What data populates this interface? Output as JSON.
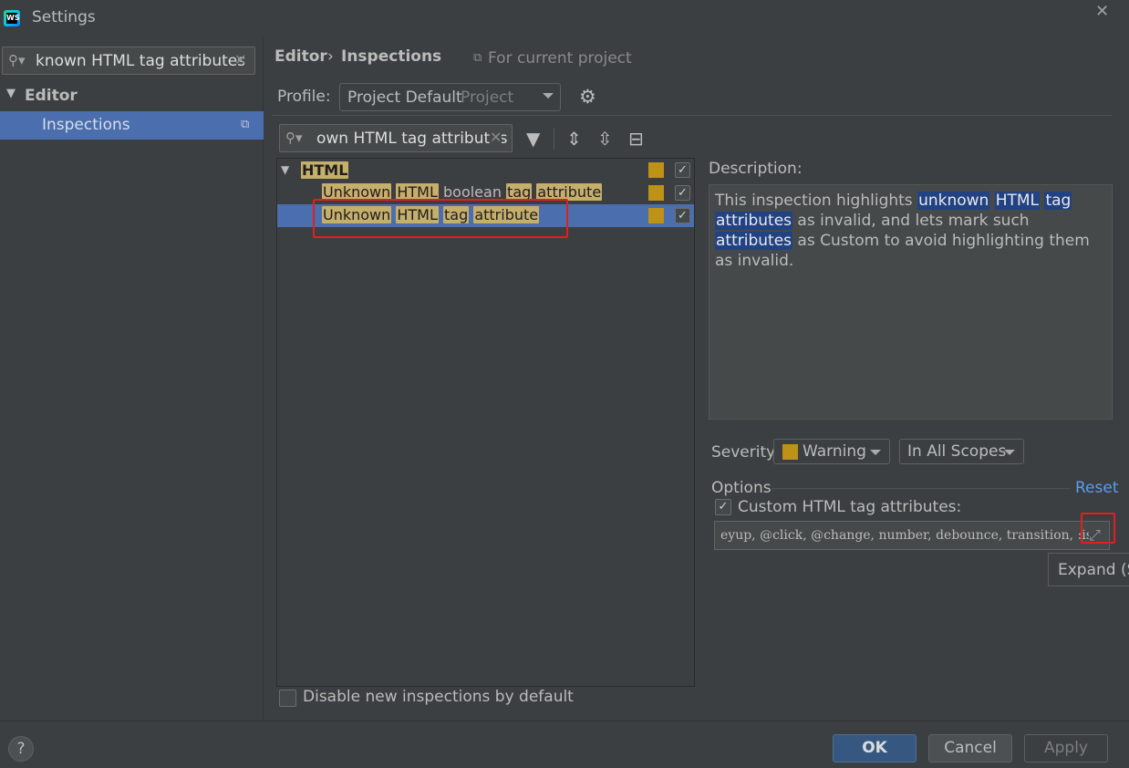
{
  "window": {
    "title": "Settings",
    "close_glyph": "✕"
  },
  "left": {
    "search_value": "known HTML tag attributes",
    "tree": {
      "editor_label": "Editor",
      "inspections_label": "Inspections"
    }
  },
  "header": {
    "breadcrumb_editor": "Editor",
    "breadcrumb_sep": "›",
    "breadcrumb_inspections": "Inspections",
    "scope_hint": "For current project",
    "profile_label": "Profile:",
    "profile_value": "Project Default",
    "profile_kind": "Project"
  },
  "inspections": {
    "search_value": "own HTML tag attributes",
    "group": {
      "words": [
        "HTML"
      ]
    },
    "rows": [
      {
        "segments": [
          {
            "t": "Unknown",
            "hl": true
          },
          {
            "t": " ",
            "hl": false
          },
          {
            "t": "HTML",
            "hl": true
          },
          {
            "t": " boolean ",
            "hl": false
          },
          {
            "t": "tag",
            "hl": true
          },
          {
            "t": " ",
            "hl": false
          },
          {
            "t": "attribute",
            "hl": true
          }
        ]
      },
      {
        "segments": [
          {
            "t": "Unknown",
            "hl": true
          },
          {
            "t": " ",
            "hl": false
          },
          {
            "t": "HTML",
            "hl": true
          },
          {
            "t": " ",
            "hl": false
          },
          {
            "t": "tag",
            "hl": true
          },
          {
            "t": " ",
            "hl": false
          },
          {
            "t": "attribute",
            "hl": true
          }
        ]
      }
    ],
    "disable_new_label": "Disable new inspections by default"
  },
  "description": {
    "label": "Description:",
    "segments": [
      {
        "t": "This inspection highlights ",
        "hl": false
      },
      {
        "t": "unknown",
        "hl": true
      },
      {
        "t": " ",
        "hl": false
      },
      {
        "t": "HTML",
        "hl": true
      },
      {
        "t": " ",
        "hl": false
      },
      {
        "t": "tag",
        "hl": true
      },
      {
        "t": " ",
        "hl": false
      },
      {
        "t": "attributes",
        "hl": true
      },
      {
        "t": " as invalid, and lets mark such ",
        "hl": false
      },
      {
        "t": "attributes",
        "hl": true
      },
      {
        "t": " as Custom to avoid highlighting them as invalid.",
        "hl": false
      }
    ]
  },
  "severity": {
    "label": "Severity:",
    "value": "Warning",
    "scope_value": "In All Scopes",
    "color": "#be9117"
  },
  "options": {
    "label": "Options",
    "reset_label": "Reset",
    "custom_label": "Custom HTML tag attributes:",
    "custom_value": "eyup, @click, @change, number, debounce, transition, :is",
    "tooltip": "Expand (Shift+Enter)"
  },
  "footer": {
    "help": "?",
    "ok": "OK",
    "cancel": "Cancel",
    "apply": "Apply"
  },
  "colors": {
    "highlight": "#c6ae6b",
    "selection": "#4b6eaf",
    "accent_link": "#589df6"
  }
}
